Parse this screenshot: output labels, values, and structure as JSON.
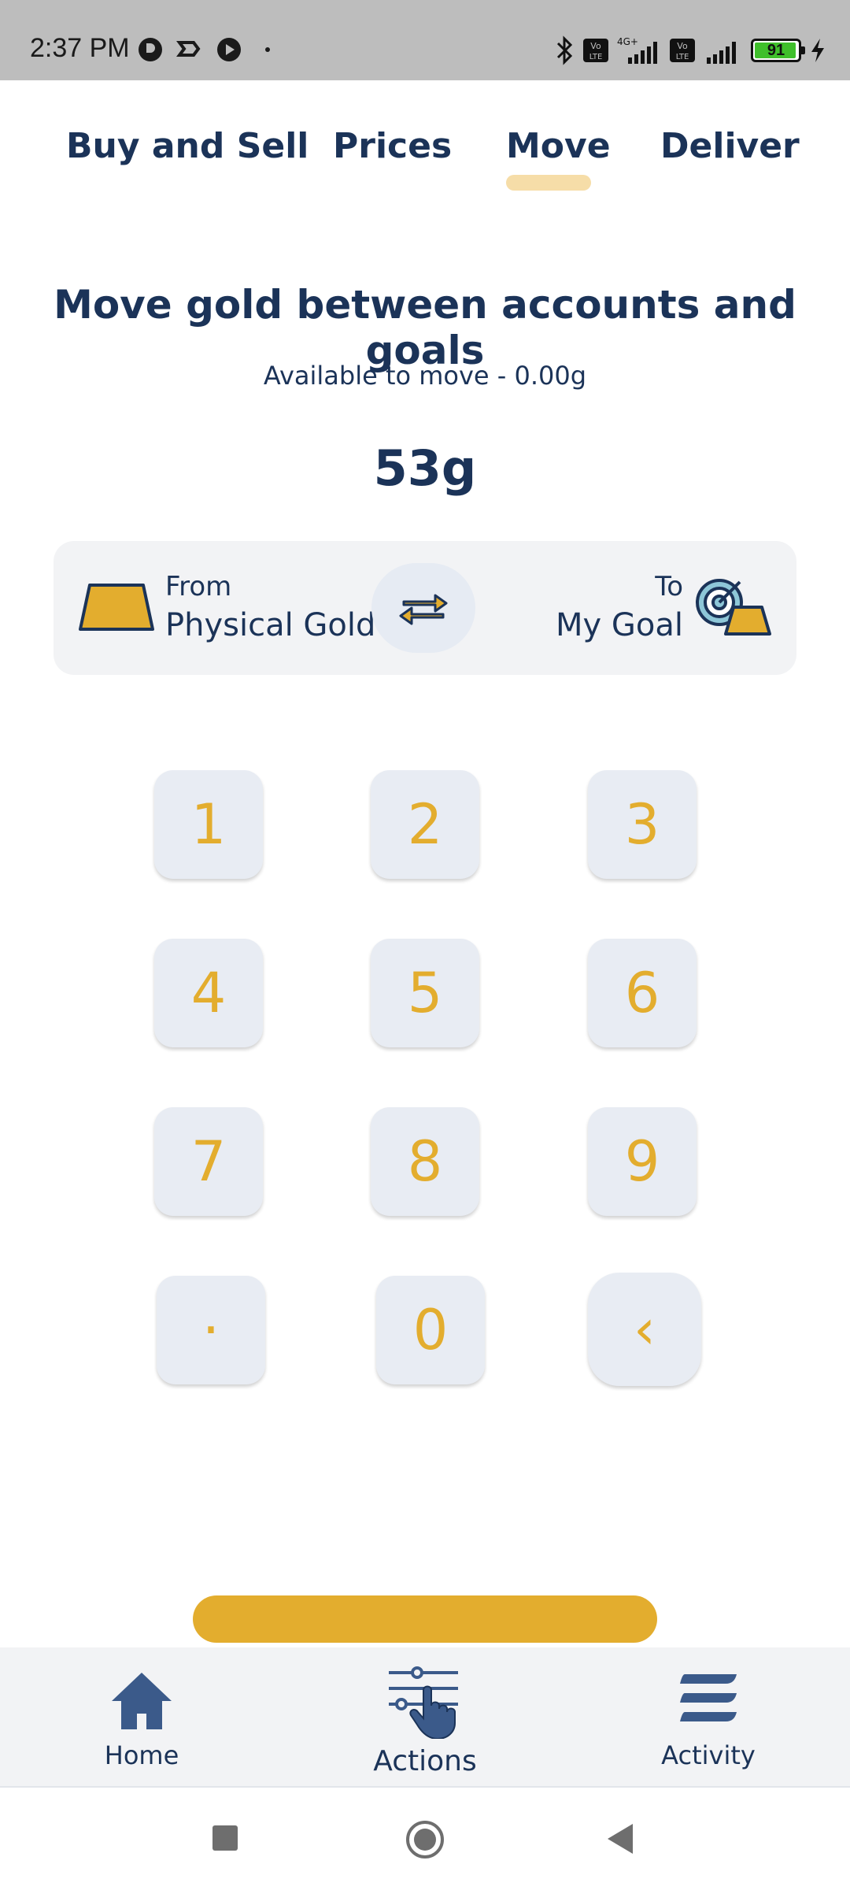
{
  "status_bar": {
    "time": "2:37 PM",
    "battery": "91",
    "network": "4G+"
  },
  "tabs": [
    {
      "label": "Buy and Sell"
    },
    {
      "label": "Prices"
    },
    {
      "label": "Move",
      "active": true
    },
    {
      "label": "Deliver"
    }
  ],
  "move": {
    "title": "Move gold between accounts and goals",
    "available": "Available to move - 0.00g",
    "amount": "53g",
    "from_label": "From",
    "from_value": "Physical Gold",
    "to_label": "To",
    "to_value": "My Goal"
  },
  "keypad": {
    "keys": [
      "1",
      "2",
      "3",
      "4",
      "5",
      "6",
      "7",
      "8",
      "9",
      "·",
      "0",
      "‹"
    ]
  },
  "bottom_nav": {
    "home": "Home",
    "actions": "Actions",
    "activity": "Activity"
  },
  "colors": {
    "navy": "#1b3358",
    "gold": "#e3ad2e",
    "key_bg": "#e8ecf3",
    "tab_highlight": "#f6dda8"
  }
}
